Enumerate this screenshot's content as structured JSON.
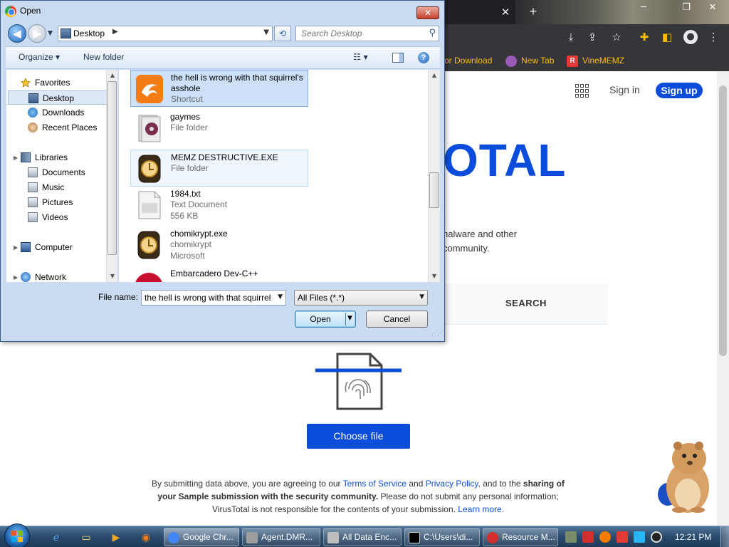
{
  "chrome": {
    "tab_close": "✕",
    "new_tab": "+",
    "window_controls": [
      "─",
      "❐",
      "✕"
    ],
    "toolbar_icons": [
      "download-icon",
      "share-icon",
      "star-icon",
      "extensions-icon",
      "sidebar-icon",
      "profile-icon",
      "menu-icon"
    ],
    "bookmarks": [
      {
        "label": "or Download",
        "icon_color": "#e8a33d"
      },
      {
        "label": "New Tab",
        "icon_color": "#9b59b6"
      },
      {
        "label": "VineMEMZ",
        "icon_color": "#e53935",
        "icon_letter": "R"
      }
    ]
  },
  "virustotal": {
    "sign_in": "Sign in",
    "sign_up": "Sign up",
    "logo_text": "OTAL",
    "desc_line1": "nalware and other",
    "desc_line2": "community.",
    "tab_search": "SEARCH",
    "choose_file": "Choose file",
    "terms": {
      "t1": "By submitting data above, you are agreeing to our ",
      "tos": "Terms of Service",
      "t2": " and ",
      "privacy": "Privacy Policy",
      "t3": ", and to the ",
      "bold1": "sharing of your Sample submission with the security community.",
      "t4": " Please do not submit any personal information; VirusTotal is not responsible for the contents of your submission. ",
      "learn": "Learn more."
    },
    "brand_color": "#0b4dda"
  },
  "dialog": {
    "title": "Open",
    "close": "✕",
    "address": "Desktop",
    "search_placeholder": "Search Desktop",
    "organize": "Organize ▾",
    "new_folder": "New folder",
    "help": "?",
    "nav": {
      "favorites": "Favorites",
      "desktop": "Desktop",
      "downloads": "Downloads",
      "recent_places": "Recent Places",
      "libraries": "Libraries",
      "documents": "Documents",
      "music": "Music",
      "pictures": "Pictures",
      "videos": "Videos",
      "computer": "Computer",
      "network": "Network"
    },
    "files": [
      {
        "name": "the hell is wrong with that squirrel's asshole",
        "type": "Shortcut",
        "state": "selected",
        "icon": "uc-browser-icon"
      },
      {
        "name": "gaymes",
        "type": "File folder",
        "state": "normal",
        "icon": "folder-icon"
      },
      {
        "name": "MEMZ DESTRUCTIVE.EXE",
        "type": "File folder",
        "state": "hover",
        "icon": "memz-icon"
      },
      {
        "name": "1984.txt",
        "type": "Text Document",
        "size": "556 KB",
        "state": "normal",
        "icon": "text-file-icon"
      },
      {
        "name": "chomikrypt.exe",
        "type": "chomikrypt",
        "size": "Microsoft",
        "state": "normal",
        "icon": "memz-icon"
      },
      {
        "name": "Embarcadero Dev-C++",
        "state": "normal",
        "icon": "devcpp-icon"
      }
    ],
    "file_name_label": "File name:",
    "file_name_value": "the hell is wrong with that squirrel",
    "file_type": "All Files (*.*)",
    "open_button": "Open",
    "cancel_button": "Cancel"
  },
  "taskbar": {
    "tasks": [
      {
        "label": "Google Chr...",
        "icon_color": "#4285f4"
      },
      {
        "label": "Agent.DMR...",
        "icon_color": "#9e9e9e"
      },
      {
        "label": "All Data Enc...",
        "icon_color": "#bdbdbd"
      },
      {
        "label": "C:\\Users\\di...",
        "icon_color": "#000000"
      },
      {
        "label": "Resource M...",
        "icon_color": "#d32f2f"
      }
    ],
    "time": "12:21 PM"
  }
}
